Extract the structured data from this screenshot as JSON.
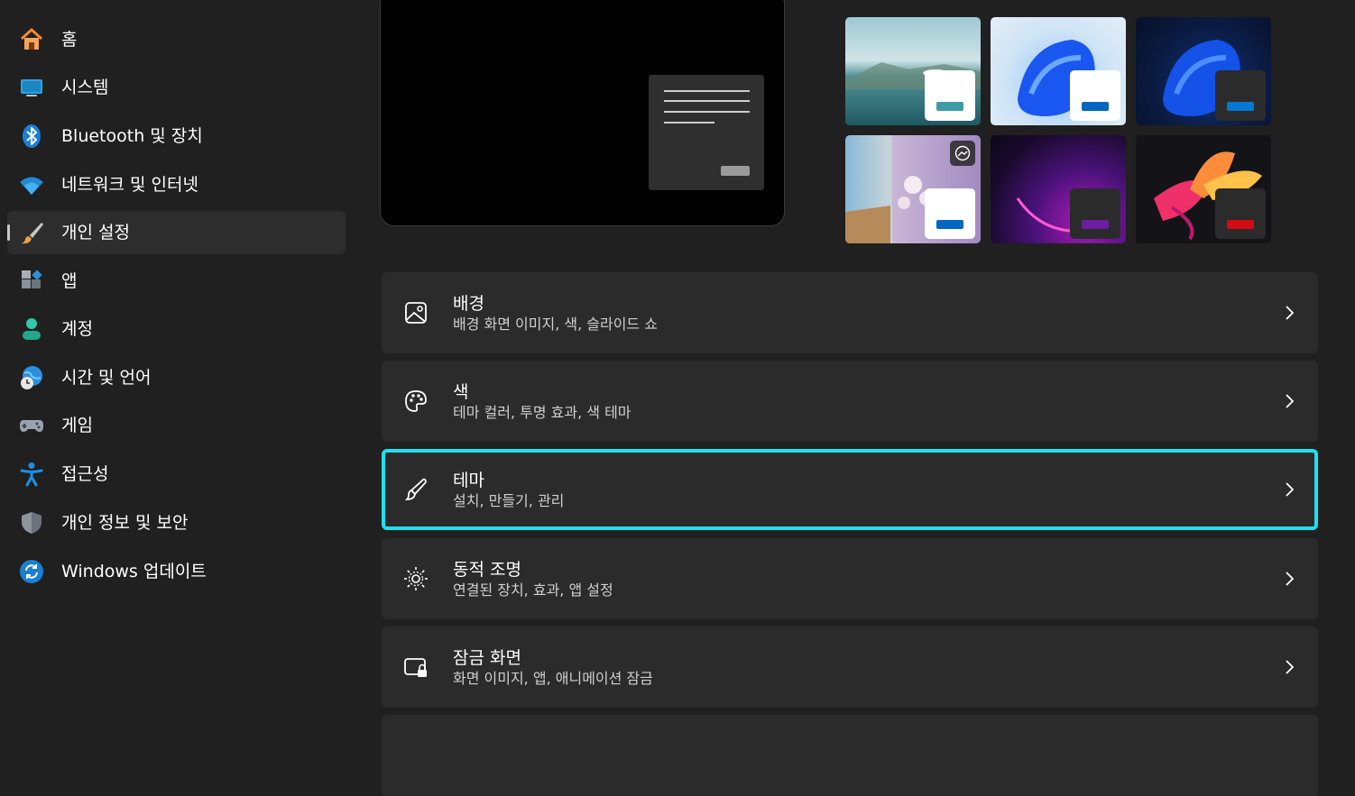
{
  "sidebar": {
    "items": [
      {
        "label": "홈",
        "icon": "home-icon"
      },
      {
        "label": "시스템",
        "icon": "monitor-icon"
      },
      {
        "label": "Bluetooth 및 장치",
        "icon": "bluetooth-icon"
      },
      {
        "label": "네트워크 및 인터넷",
        "icon": "wifi-icon"
      },
      {
        "label": "개인 설정",
        "icon": "brush-icon",
        "selected": true
      },
      {
        "label": "앱",
        "icon": "apps-icon"
      },
      {
        "label": "계정",
        "icon": "person-icon"
      },
      {
        "label": "시간 및 언어",
        "icon": "globe-clock-icon"
      },
      {
        "label": "게임",
        "icon": "gamepad-icon"
      },
      {
        "label": "접근성",
        "icon": "accessibility-icon"
      },
      {
        "label": "개인 정보 및 보안",
        "icon": "shield-icon"
      },
      {
        "label": "Windows 업데이트",
        "icon": "update-icon"
      }
    ]
  },
  "themes": [
    {
      "name": "glow-lake",
      "accent": "#3d9ba8"
    },
    {
      "name": "bloom-light",
      "accent": "#0067c0"
    },
    {
      "name": "bloom-dark",
      "accent": "#0078d4"
    },
    {
      "name": "spotlight",
      "accent": "#0067c0"
    },
    {
      "name": "glow-purple",
      "accent": "#6b1fa0"
    },
    {
      "name": "flow-red",
      "accent": "#d40a14"
    }
  ],
  "cards": [
    {
      "title": "배경",
      "subtitle": "배경 화면 이미지, 색, 슬라이드 쇼",
      "icon": "image-icon"
    },
    {
      "title": "색",
      "subtitle": "테마 컬러, 투명 효과, 색 테마",
      "icon": "palette-icon"
    },
    {
      "title": "테마",
      "subtitle": "설치, 만들기, 관리",
      "icon": "brush-outline-icon",
      "focused": true
    },
    {
      "title": "동적 조명",
      "subtitle": "연결된 장치, 효과, 앱 설정",
      "icon": "lighting-icon"
    },
    {
      "title": "잠금 화면",
      "subtitle": "화면 이미지, 앱, 애니메이션 잠금",
      "icon": "lock-screen-icon"
    }
  ],
  "colors": {
    "focus_outline": "#1ee0f0",
    "background": "#202020",
    "card": "#2b2b2b"
  }
}
